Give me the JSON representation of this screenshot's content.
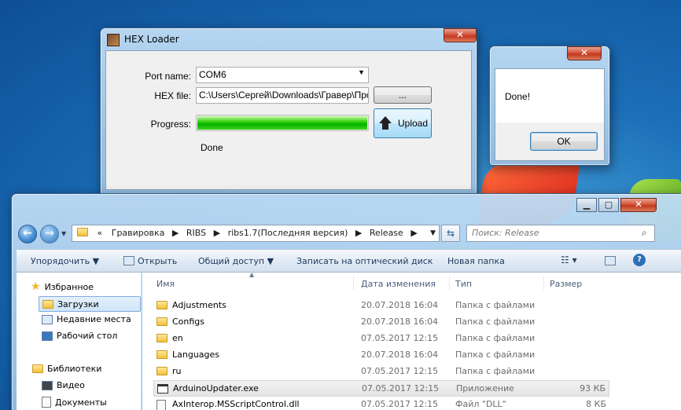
{
  "hex_loader": {
    "title": "HEX Loader",
    "close": "✕",
    "port_label": "Port name:",
    "port_value": "COM6",
    "hex_label": "HEX file:",
    "hex_value": "C:\\Users\\Сергей\\Downloads\\Гравер\\Прош",
    "browse_label": "...",
    "progress_label": "Progress:",
    "progress_value": 1.0,
    "upload_label": "Upload",
    "status": "Done"
  },
  "message_box": {
    "text": "Done!",
    "ok_label": "OK",
    "close": "✕"
  },
  "explorer": {
    "breadcrumb": [
      "«",
      "Гравировка",
      "RIBS",
      "ribs1.7(Последняя версия)",
      "Release"
    ],
    "search_placeholder": "Поиск: Release",
    "toolbar": {
      "organize": "Упорядочить ▼",
      "open": "Открыть",
      "share": "Общий доступ ▼",
      "burn": "Записать на оптический диск",
      "new_folder": "Новая папка"
    },
    "nav": {
      "favorites": "Избранное",
      "downloads": "Загрузки",
      "recent": "Недавние места",
      "desktop": "Рабочий стол",
      "libraries": "Библиотеки",
      "video": "Видео",
      "documents": "Документы"
    },
    "columns": {
      "name": "Имя",
      "date": "Дата изменения",
      "type": "Тип",
      "size": "Размер"
    },
    "files": [
      {
        "name": "Adjustments",
        "date": "20.07.2018 16:04",
        "type": "Папка с файлами",
        "size": ""
      },
      {
        "name": "Configs",
        "date": "20.07.2018 16:04",
        "type": "Папка с файлами",
        "size": ""
      },
      {
        "name": "en",
        "date": "07.05.2017 12:15",
        "type": "Папка с файлами",
        "size": ""
      },
      {
        "name": "Languages",
        "date": "20.07.2018 16:04",
        "type": "Папка с файлами",
        "size": ""
      },
      {
        "name": "ru",
        "date": "07.05.2017 12:15",
        "type": "Папка с файлами",
        "size": ""
      },
      {
        "name": "ArduinoUpdater.exe",
        "date": "07.05.2017 12:15",
        "type": "Приложение",
        "size": "93 КБ"
      },
      {
        "name": "AxInterop.MSScriptControl.dll",
        "date": "07.05.2017 12:15",
        "type": "Файл \"DLL\"",
        "size": "8 КБ"
      }
    ]
  }
}
